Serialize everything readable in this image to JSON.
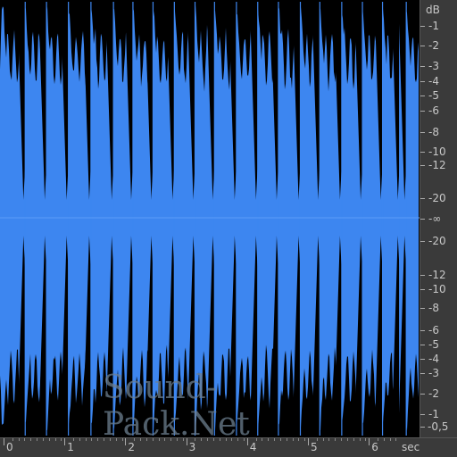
{
  "waveform": {
    "color": "#3d86f0",
    "background": "#000000",
    "hit_times_sec": [
      0.0,
      0.37,
      0.72,
      1.08,
      1.45,
      1.82,
      2.14,
      2.47,
      2.82,
      3.16,
      3.48,
      3.84,
      4.19,
      4.53,
      4.89,
      5.21,
      5.57,
      5.91,
      6.24,
      6.52,
      6.63
    ]
  },
  "db_scale": {
    "unit_label": "dB",
    "labels": [
      "-1",
      "-2",
      "-3",
      "-4",
      "-5",
      "-6",
      "-8",
      "-10",
      "-12",
      "-20",
      "-∞",
      "-20",
      "-12",
      "-10",
      "-8",
      "-6",
      "-5",
      "-4",
      "-3",
      "-2",
      "-1",
      "-0,5"
    ]
  },
  "time_ruler": {
    "labels": [
      "0",
      "1",
      "2",
      "3",
      "4",
      "5",
      "6"
    ],
    "unit_label": "sec"
  },
  "watermark": "Sound-Pack.Net"
}
